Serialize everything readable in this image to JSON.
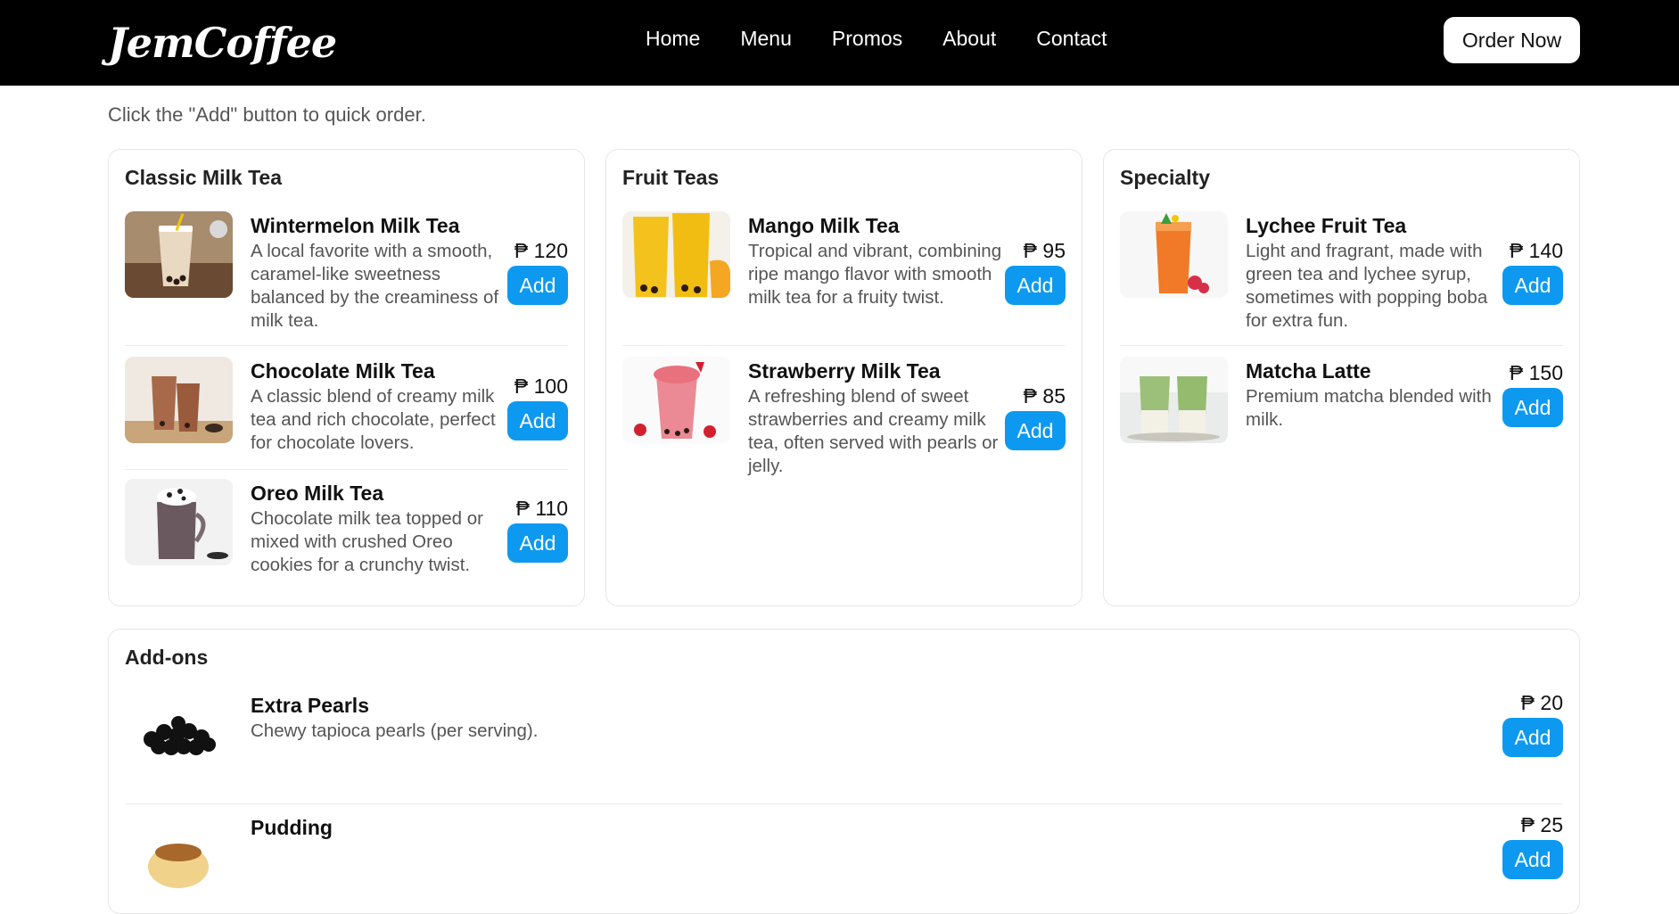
{
  "brand": {
    "logo_text": "JemCoffee"
  },
  "nav": {
    "items": [
      "Home",
      "Menu",
      "Promos",
      "About",
      "Contact"
    ],
    "cta": "Order Now"
  },
  "hint": "Click the \"Add\" button to quick order.",
  "currency": "₱",
  "categories": [
    {
      "title": "Classic Milk Tea",
      "items": [
        {
          "name": "Wintermelon Milk Tea",
          "desc": "A local favorite with a smooth, caramel-like sweetness balanced by the creaminess of milk tea.",
          "price": "₱ 120",
          "add_label": "Add"
        },
        {
          "name": "Chocolate Milk Tea",
          "desc": "A classic blend of creamy milk tea and rich chocolate, perfect for chocolate lovers.",
          "price": "₱ 100",
          "add_label": "Add"
        },
        {
          "name": "Oreo Milk Tea",
          "desc": "Chocolate milk tea topped or mixed with crushed Oreo cookies for a crunchy twist.",
          "price": "₱ 110",
          "add_label": "Add"
        }
      ]
    },
    {
      "title": "Fruit Teas",
      "items": [
        {
          "name": "Mango Milk Tea",
          "desc": "Tropical and vibrant, combining ripe mango flavor with smooth milk tea for a fruity twist.",
          "price": "₱ 95",
          "add_label": "Add"
        },
        {
          "name": "Strawberry Milk Tea",
          "desc": "A refreshing blend of sweet strawberries and creamy milk tea, often served with pearls or jelly.",
          "price": "₱ 85",
          "add_label": "Add"
        }
      ]
    },
    {
      "title": "Specialty",
      "items": [
        {
          "name": "Lychee Fruit Tea",
          "desc": "Light and fragrant, made with green tea and lychee syrup, sometimes with popping boba for extra fun.",
          "price": "₱ 140",
          "add_label": "Add"
        },
        {
          "name": "Matcha Latte",
          "desc": "Premium matcha blended with milk.",
          "price": "₱ 150",
          "add_label": "Add"
        }
      ]
    },
    {
      "title": "Add-ons",
      "items": [
        {
          "name": "Extra Pearls",
          "desc": "Chewy tapioca pearls (per serving).",
          "price": "₱ 20",
          "add_label": "Add"
        },
        {
          "name": "Pudding",
          "desc": "",
          "price": "₱ 25",
          "add_label": "Add"
        }
      ]
    }
  ]
}
